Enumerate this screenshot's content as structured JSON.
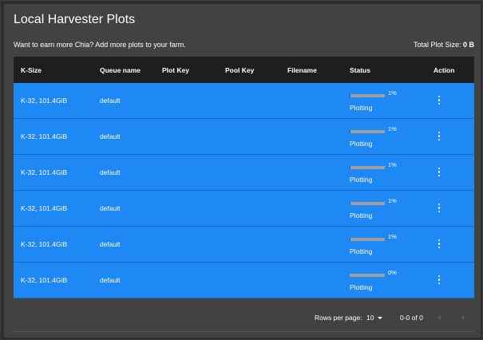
{
  "page": {
    "title": "Local Harvester Plots",
    "promo_text": "Want to earn more Chia? Add more plots to your farm.",
    "total_label": "Total Plot Size:",
    "total_value": "0 B"
  },
  "table": {
    "headers": {
      "ksize": "K-Size",
      "queue": "Queue name",
      "plot_key": "Plot Key",
      "pool_key": "Pool Key",
      "filename": "Filename",
      "status": "Status",
      "action": "Action"
    },
    "rows": [
      {
        "ksize": "K-32, 101.4GiB",
        "queue": "default",
        "plot_key": "",
        "pool_key": "",
        "filename": "",
        "progress_pct": "1%",
        "progress": 1,
        "status": "Plotting"
      },
      {
        "ksize": "K-32, 101.4GiB",
        "queue": "default",
        "plot_key": "",
        "pool_key": "",
        "filename": "",
        "progress_pct": "1%",
        "progress": 1,
        "status": "Plotting"
      },
      {
        "ksize": "K-32, 101.4GiB",
        "queue": "default",
        "plot_key": "",
        "pool_key": "",
        "filename": "",
        "progress_pct": "1%",
        "progress": 1,
        "status": "Plotting"
      },
      {
        "ksize": "K-32, 101.4GiB",
        "queue": "default",
        "plot_key": "",
        "pool_key": "",
        "filename": "",
        "progress_pct": "1%",
        "progress": 1,
        "status": "Plotting"
      },
      {
        "ksize": "K-32, 101.4GiB",
        "queue": "default",
        "plot_key": "",
        "pool_key": "",
        "filename": "",
        "progress_pct": "1%",
        "progress": 1,
        "status": "Plotting"
      },
      {
        "ksize": "K-32, 101.4GiB",
        "queue": "default",
        "plot_key": "",
        "pool_key": "",
        "filename": "",
        "progress_pct": "0%",
        "progress": 0,
        "status": "Plotting"
      }
    ]
  },
  "pagination": {
    "rows_per_page_label": "Rows per page:",
    "rows_per_page_value": "10",
    "range": "0-0 of 0"
  },
  "icons": {
    "action": "more-vert-icon",
    "prev": "chevron-left-icon",
    "next": "chevron-right-icon",
    "select": "caret-down-icon"
  },
  "colors": {
    "row_background": "#1e88f5",
    "header_background": "#1e1e1e",
    "card_background": "#424242",
    "progress_track": "#9e9e9e",
    "progress_fill": "#1565c0"
  }
}
